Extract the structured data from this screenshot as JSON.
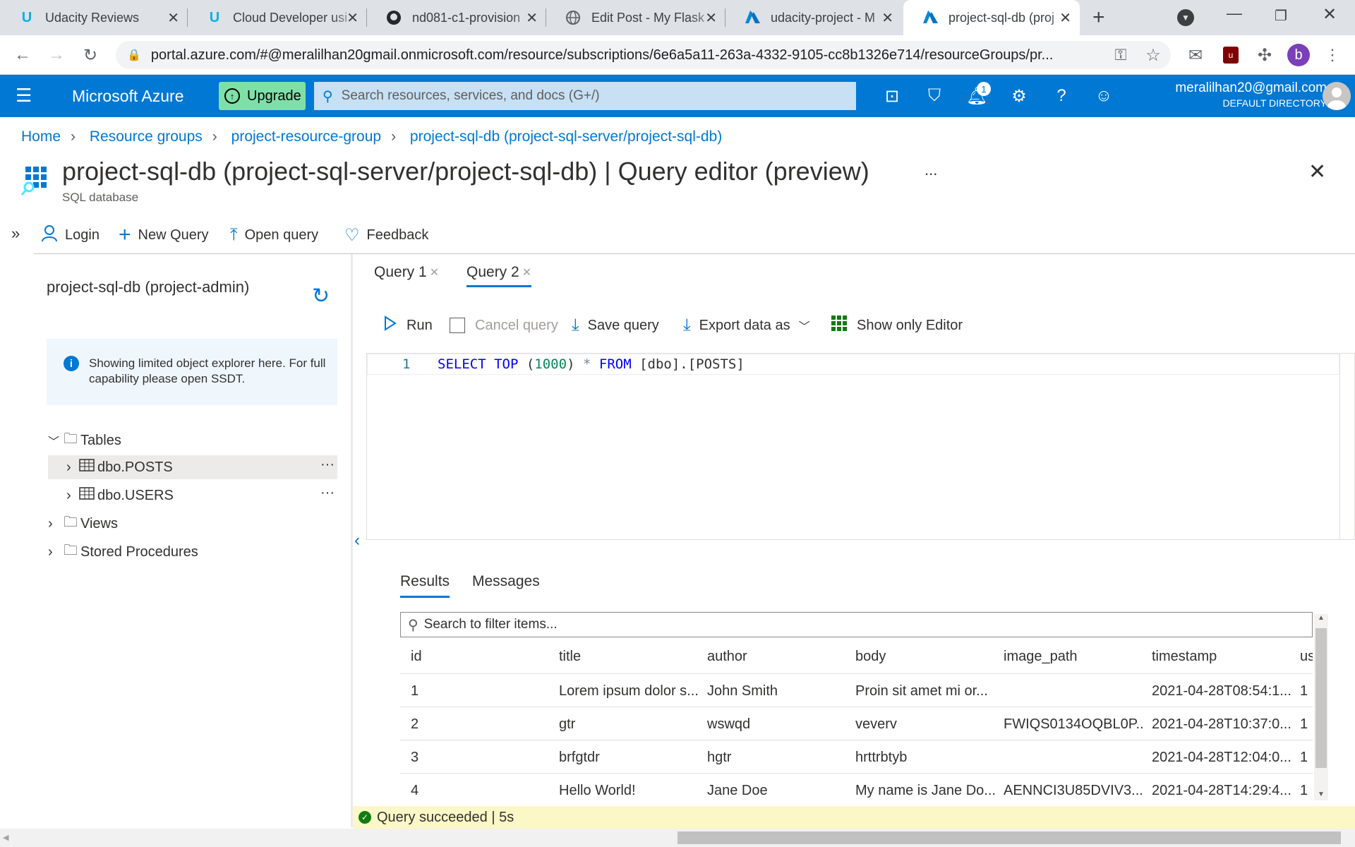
{
  "browser": {
    "tabs": [
      {
        "title": "Udacity Reviews",
        "icon": "udacity-icon"
      },
      {
        "title": "Cloud Developer usi",
        "icon": "udacity-icon"
      },
      {
        "title": "nd081-c1-provision",
        "icon": "github-icon"
      },
      {
        "title": "Edit Post - My Flask",
        "icon": "globe-icon"
      },
      {
        "title": "udacity-project - M",
        "icon": "azure-icon"
      },
      {
        "title": "project-sql-db (proj",
        "icon": "azure-icon"
      }
    ],
    "url": "portal.azure.com/#@meralilhan20gmail.onmicrosoft.com/resource/subscriptions/6e6a5a11-263a-4332-9105-cc8b1326e714/resourceGroups/pr...",
    "profile_initial": "b"
  },
  "azure": {
    "brand": "Microsoft Azure",
    "upgrade_label": "Upgrade",
    "search_placeholder": "Search resources, services, and docs (G+/)",
    "notification_count": "1",
    "user_email": "meralilhan20@gmail.com",
    "user_directory": "DEFAULT DIRECTORY",
    "accent": "#0078d4"
  },
  "breadcrumb": [
    "Home",
    "Resource groups",
    "project-resource-group",
    "project-sql-db (project-sql-server/project-sql-db)"
  ],
  "page": {
    "title": "project-sql-db (project-sql-server/project-sql-db) | Query editor (preview)",
    "subtitle": "SQL database",
    "more": "...",
    "toolbar": [
      "Login",
      "New Query",
      "Open query",
      "Feedback"
    ]
  },
  "explorer": {
    "db_label": "project-sql-db (project-admin)",
    "info_text": "Showing limited object explorer here. For full capability please open SSDT.",
    "tables_label": "Tables",
    "tables": [
      "dbo.POSTS",
      "dbo.USERS"
    ],
    "views_label": "Views",
    "procs_label": "Stored Procedures"
  },
  "query": {
    "tabs": [
      "Query 1",
      "Query 2"
    ],
    "active_tab": 1,
    "toolbar": {
      "run": "Run",
      "cancel": "Cancel query",
      "save": "Save query",
      "export": "Export data as",
      "show_editor": "Show only Editor"
    },
    "line_number": "1",
    "code": {
      "kw1": "SELECT TOP",
      "paren_open": "(",
      "num": "1000",
      "paren_close": ")",
      "star": "*",
      "kw2": "FROM",
      "obj": "[dbo].[POSTS]"
    }
  },
  "results": {
    "tabs": [
      "Results",
      "Messages"
    ],
    "filter_placeholder": "Search to filter items...",
    "columns": [
      "id",
      "title",
      "author",
      "body",
      "image_path",
      "timestamp",
      "us"
    ],
    "rows": [
      [
        "1",
        "Lorem ipsum dolor s...",
        "John Smith",
        "Proin sit amet mi or...",
        "",
        "2021-04-28T08:54:1...",
        "1"
      ],
      [
        "2",
        "gtr",
        "wswqd",
        "veverv",
        "FWIQS0134OQBL0P...",
        "2021-04-28T10:37:0...",
        "1"
      ],
      [
        "3",
        "brfgtdr",
        "hgtr",
        "hrttrbtyb",
        "",
        "2021-04-28T12:04:0...",
        "1"
      ],
      [
        "4",
        "Hello World!",
        "Jane Doe",
        "My name is Jane Do...",
        "AENNCI3U85DVIV3...",
        "2021-04-28T14:29:4...",
        "1"
      ]
    ]
  },
  "status": {
    "text": "Query succeeded | 5s"
  }
}
